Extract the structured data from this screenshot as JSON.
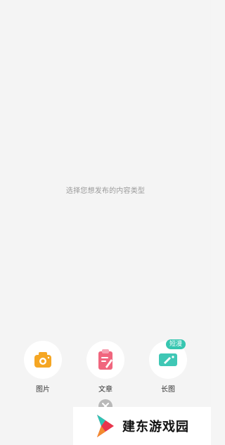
{
  "prompt_text": "选择您想发布的内容类型",
  "options": [
    {
      "label": "图片",
      "icon": "camera-icon",
      "color": "#f5a623"
    },
    {
      "label": "文章",
      "icon": "article-icon",
      "color": "#f0667e"
    },
    {
      "label": "长图",
      "icon": "long-image-icon",
      "color": "#3fc7b5",
      "badge": "短漫"
    }
  ],
  "close_icon": "close-icon",
  "watermark": {
    "text": "建东游戏园"
  }
}
